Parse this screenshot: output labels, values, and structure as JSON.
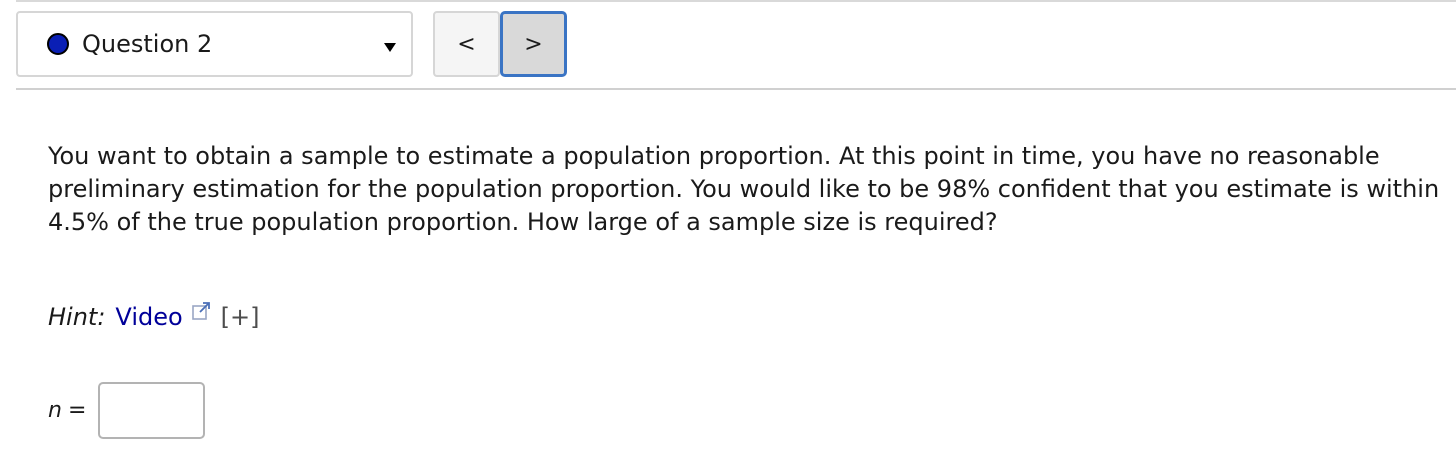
{
  "header": {
    "question_selector": {
      "label": "Question 2",
      "status_color": "#0a1fb5",
      "icon": "chevron-down-icon"
    },
    "prev_label": "<",
    "next_label": ">"
  },
  "question": {
    "text": "You want to obtain a sample to estimate a population proportion. At this point in time, you have no reasonable preliminary estimation for the population proportion. You would like to be 98% confident that you estimate is within 4.5% of the true population proportion. How large of a sample size is required?"
  },
  "hint": {
    "label": "Hint:",
    "link_text": "Video",
    "link_icon": "external-link-icon",
    "expand_text": "[+]"
  },
  "answer": {
    "variable": "n",
    "equals": "=",
    "value": "",
    "placeholder": ""
  },
  "colors": {
    "accent_border": "#3a74c4",
    "link": "#000099"
  }
}
